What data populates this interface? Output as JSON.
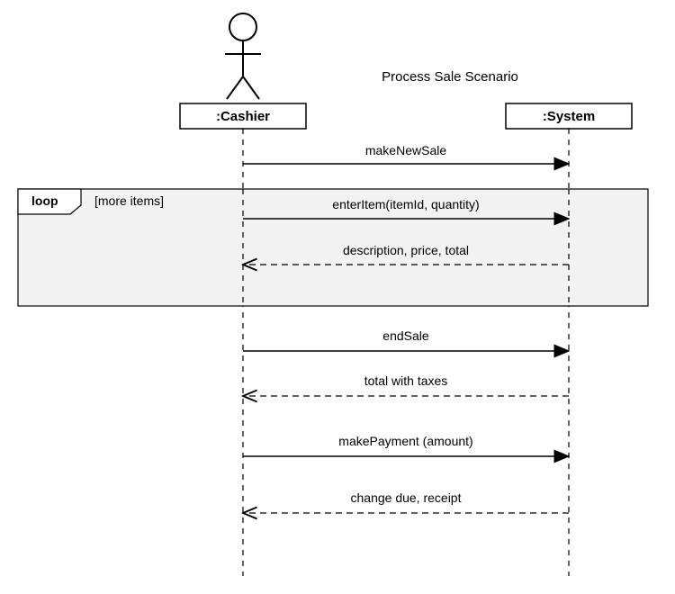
{
  "title": "Process Sale Scenario",
  "participants": {
    "cashier": ":Cashier",
    "system": ":System"
  },
  "loop": {
    "label": "loop",
    "guard": "[more items]"
  },
  "messages": {
    "m1": "makeNewSale",
    "m2": "enterItem(itemId, quantity)",
    "m3": "description, price, total",
    "m4": "endSale",
    "m5": "total with taxes",
    "m6": "makePayment (amount)",
    "m7": "change due, receipt"
  }
}
